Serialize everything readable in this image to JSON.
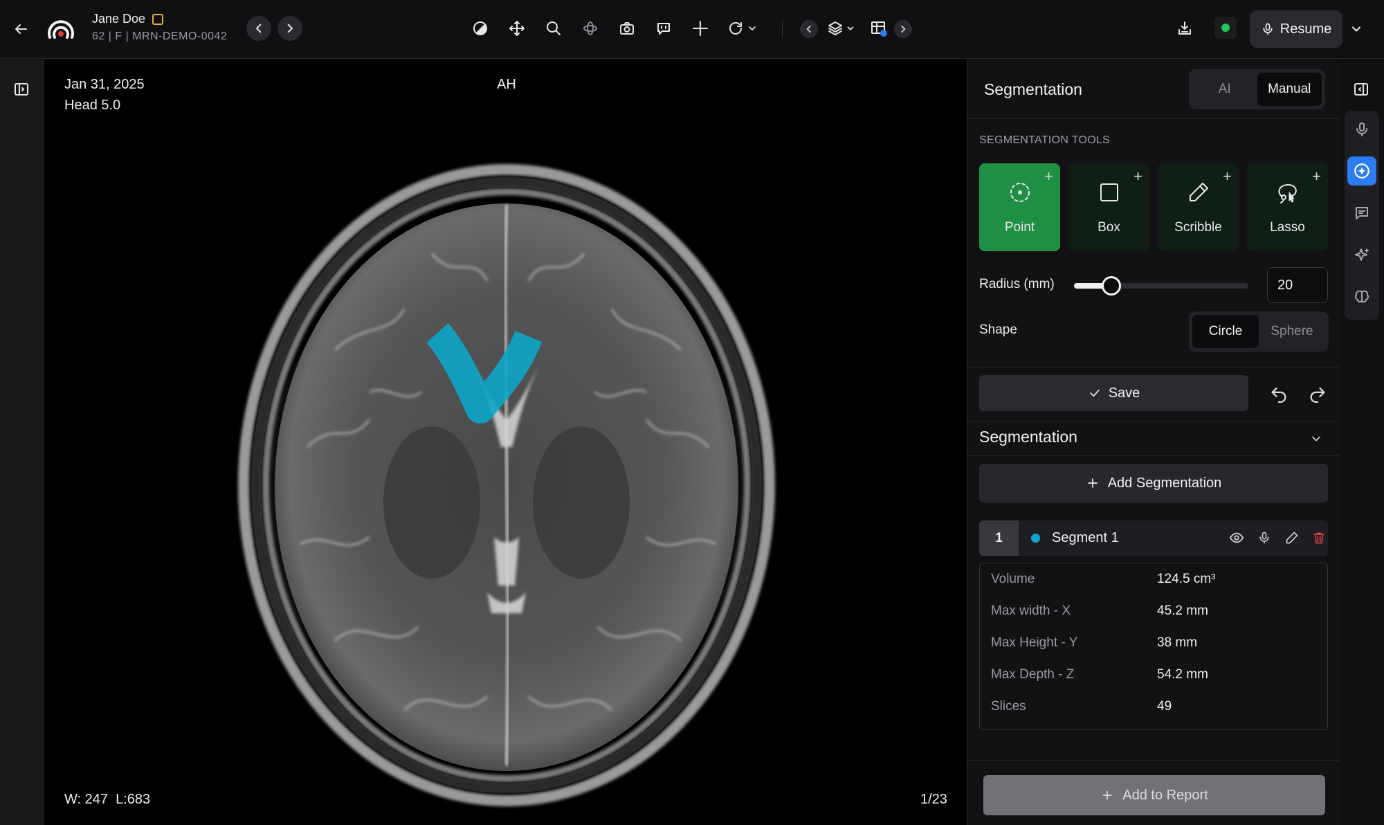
{
  "patient": {
    "name": "Jane Doe",
    "details": "62 | F | MRN-DEMO-0042"
  },
  "toolbar": {
    "resume_label": "Resume"
  },
  "viewer": {
    "date": "Jan 31, 2025",
    "series": "Head 5.0",
    "orientation": "AH",
    "window_level": "W: 247  L:683",
    "slice": "1/23",
    "segmentation_color": "#0aa6c9"
  },
  "panel": {
    "title": "Segmentation",
    "mode_options": [
      "AI",
      "Manual"
    ],
    "mode_selected": "Manual",
    "tools_label": "SEGMENTATION TOOLS",
    "tools": [
      {
        "label": "Point",
        "icon": "point-icon",
        "active": true
      },
      {
        "label": "Box",
        "icon": "box-icon",
        "active": false
      },
      {
        "label": "Scribble",
        "icon": "pencil-icon",
        "active": false
      },
      {
        "label": "Lasso",
        "icon": "lasso-icon",
        "active": false
      }
    ],
    "radius_label": "Radius (mm)",
    "radius_value": "20",
    "radius_fraction": 0.16,
    "shape_label": "Shape",
    "shape_options": [
      "Circle",
      "Sphere"
    ],
    "shape_selected": "Circle",
    "save_label": "Save",
    "segmentation_header": "Segmentation",
    "add_segmentation_label": "Add Segmentation",
    "segment": {
      "number": "1",
      "name": "Segment 1",
      "color": "#0aa6c9"
    },
    "stats": [
      {
        "label": "Volume",
        "value": "124.5 cm³"
      },
      {
        "label": "Max width - X",
        "value": "45.2 mm"
      },
      {
        "label": "Max Height - Y",
        "value": "38 mm"
      },
      {
        "label": "Max Depth - Z",
        "value": "54.2 mm"
      },
      {
        "label": "Slices",
        "value": "49"
      }
    ],
    "add_to_report_label": "Add to Report"
  },
  "colors": {
    "accent_green": "#1f8f44",
    "accent_blue": "#2b7cf0",
    "status_green": "#22c55e",
    "delete_red": "#d94545"
  }
}
